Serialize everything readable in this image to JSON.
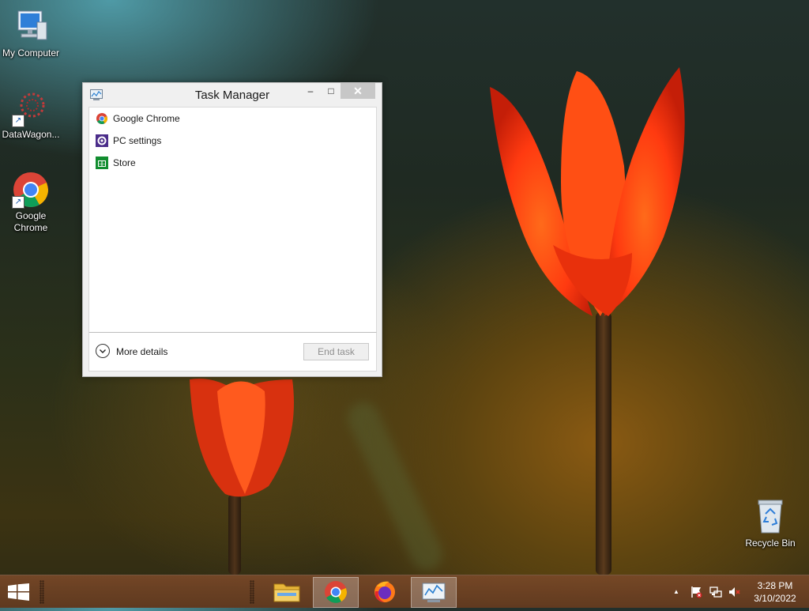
{
  "desktop": {
    "icons": [
      {
        "label": "My Computer"
      },
      {
        "label": "DataWagon..."
      },
      {
        "label": "Google Chrome"
      },
      {
        "label": "Recycle Bin"
      }
    ]
  },
  "task_manager": {
    "title": "Task Manager",
    "controls": {
      "minimize": "–",
      "maximize": "□",
      "close": "✕"
    },
    "apps": [
      {
        "name": "Google Chrome",
        "icon": "chrome-icon"
      },
      {
        "name": "PC settings",
        "icon": "pc-settings-icon"
      },
      {
        "name": "Store",
        "icon": "store-icon"
      }
    ],
    "more_details": "More details",
    "end_task": "End task"
  },
  "taskbar": {
    "apps": [
      {
        "name": "File Explorer",
        "icon": "file-explorer-icon"
      },
      {
        "name": "Google Chrome",
        "icon": "chrome-icon"
      },
      {
        "name": "Firefox",
        "icon": "firefox-icon"
      },
      {
        "name": "Task Manager",
        "icon": "task-manager-icon"
      }
    ],
    "tray": {
      "show_hidden": "▲"
    },
    "clock": {
      "time": "3:28 PM",
      "date": "3/10/2022"
    }
  },
  "colors": {
    "accent_close": "#c7c7c7",
    "taskbar": "#7a4a2a",
    "flower": "#ff4a1a"
  }
}
